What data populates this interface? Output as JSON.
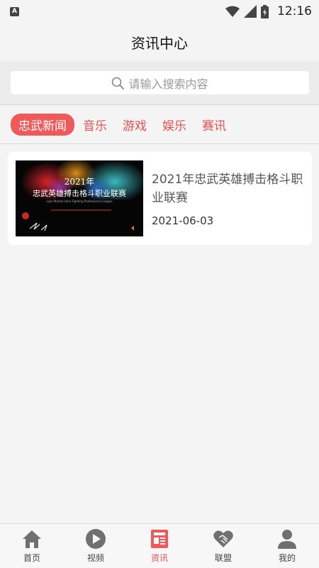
{
  "status_bar": {
    "indicator": "A",
    "time": "12:16"
  },
  "header": {
    "title": "资讯中心"
  },
  "search": {
    "placeholder": "请输入搜索内容"
  },
  "tabs": [
    {
      "label": "忠武新闻",
      "active": true
    },
    {
      "label": "音乐",
      "active": false
    },
    {
      "label": "游戏",
      "active": false
    },
    {
      "label": "娱乐",
      "active": false
    },
    {
      "label": "赛讯",
      "active": false
    }
  ],
  "news": [
    {
      "title": "2021年忠武英雄搏击格斗职业联赛",
      "date": "2021-06-03",
      "thumb_year": "2021年",
      "thumb_title": "忠武英雄搏击格斗职业联赛",
      "thumb_subtitle": "Loza Martial Hero Fighting Professional League"
    }
  ],
  "bottom_nav": [
    {
      "label": "首页",
      "icon": "home-icon",
      "active": false
    },
    {
      "label": "视频",
      "icon": "play-icon",
      "active": false
    },
    {
      "label": "资讯",
      "icon": "news-icon",
      "active": true
    },
    {
      "label": "联盟",
      "icon": "handshake-icon",
      "active": false
    },
    {
      "label": "我的",
      "icon": "user-icon",
      "active": false
    }
  ],
  "colors": {
    "accent": "#f0595a",
    "accent_text": "#e8504f",
    "nav_inactive": "#707070"
  }
}
